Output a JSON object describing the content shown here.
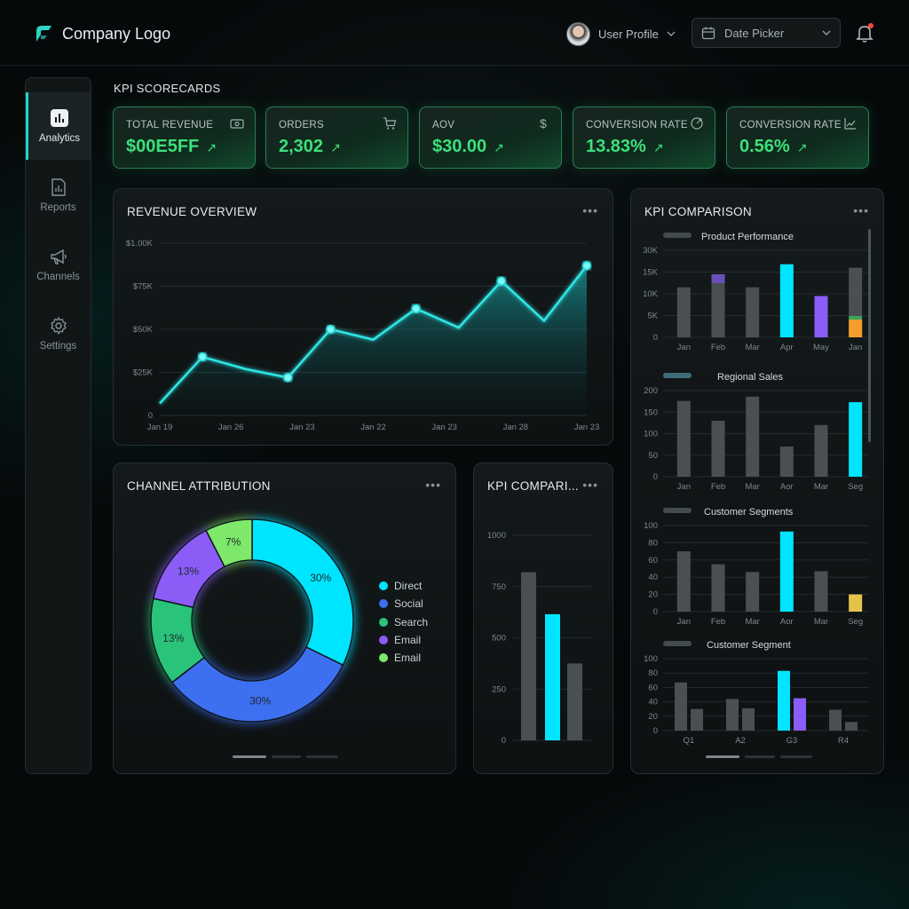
{
  "header": {
    "company": "Company Logo",
    "profile_label": "User Profile",
    "date_placeholder": "Date Picker"
  },
  "sidebar": {
    "items": [
      {
        "label": "Analytics",
        "icon": "bar-chart-icon",
        "active": true
      },
      {
        "label": "Reports",
        "icon": "document-chart-icon",
        "active": false
      },
      {
        "label": "Channels",
        "icon": "megaphone-icon",
        "active": false
      },
      {
        "label": "Settings",
        "icon": "gear-icon",
        "active": false
      }
    ]
  },
  "scorecards": {
    "title": "KPI SCORECARDS",
    "cards": [
      {
        "label": "TOTAL REVENUE",
        "value": "$00E5FF",
        "trend": "↗",
        "icon": "money-icon"
      },
      {
        "label": "ORDERS",
        "value": "2,302",
        "trend": "↗",
        "icon": "cart-icon"
      },
      {
        "label": "AOV",
        "value": "$30.00",
        "trend": "↗",
        "icon": "dollar-icon"
      },
      {
        "label": "CONVERSION RATE",
        "value": "13.83%",
        "trend": "↗",
        "icon": "target-icon"
      },
      {
        "label": "CONVERSION RATE",
        "value": "0.56%",
        "trend": "↗",
        "icon": "trend-icon"
      }
    ]
  },
  "colors": {
    "accent": "#00E5FF",
    "green": "#3DE07A",
    "blue": "#3D6FF0",
    "purple": "#8B5CF6",
    "lime": "#7EE86A",
    "gray_bar": "#4A4F51",
    "orange": "#F59E2B",
    "yellow": "#E5C34A"
  },
  "revenue_overview": {
    "title": "REVENUE OVERVIEW",
    "menu": "•••",
    "chart_data": {
      "type": "area",
      "x": [
        "Jan 19",
        "Jan 26",
        "Jan 23",
        "Jan 22",
        "Jan 23",
        "Jan 28",
        "Jan 23"
      ],
      "y_ticks": [
        "0",
        "$25K",
        "$50K",
        "$75K",
        "$1.00K"
      ],
      "ylim": [
        0,
        100
      ],
      "values": [
        7,
        34,
        27,
        22,
        50,
        44,
        62,
        51,
        78,
        55,
        87
      ],
      "markers": [
        1,
        3,
        4,
        6,
        8,
        10
      ]
    }
  },
  "kpi_comparison": {
    "title": "KPI COMPARISON",
    "menu": "•••",
    "charts": [
      {
        "title": "Product Performance",
        "type": "bar",
        "y_ticks": [
          "0",
          "5K",
          "10K",
          "15K",
          "30K"
        ],
        "ylim": [
          0,
          20
        ],
        "categories": [
          "Jan",
          "Feb",
          "Mar",
          "Apr",
          "May",
          "Jan"
        ],
        "values": [
          11.5,
          14.5,
          11.5,
          16.8,
          9.5,
          16
        ],
        "colors": [
          "gray",
          "gray-purple",
          "gray",
          "accent",
          "purple",
          "gray-orange"
        ]
      },
      {
        "title": "Regional Sales",
        "type": "bar",
        "y_ticks": [
          "0",
          "50",
          "100",
          "150",
          "200"
        ],
        "ylim": [
          0,
          200
        ],
        "categories": [
          "Jan",
          "Feb",
          "Mar",
          "Aor",
          "Mar",
          "Seg"
        ],
        "values": [
          176,
          130,
          186,
          70,
          120,
          173
        ],
        "colors": [
          "gray",
          "gray",
          "gray",
          "gray",
          "gray",
          "accent"
        ]
      },
      {
        "title": "Customer Segments",
        "type": "bar",
        "y_ticks": [
          "0",
          "20",
          "40",
          "60",
          "80",
          "100"
        ],
        "ylim": [
          0,
          100
        ],
        "categories": [
          "Jan",
          "Feb",
          "Mar",
          "Aor",
          "Mar",
          "Seg"
        ],
        "values": [
          70,
          55,
          46,
          93,
          47,
          20
        ],
        "colors": [
          "gray",
          "gray",
          "gray",
          "accent",
          "gray",
          "yellow"
        ]
      },
      {
        "title": "Customer Segment",
        "type": "bar",
        "y_ticks": [
          "0",
          "20",
          "40",
          "60",
          "80",
          "100"
        ],
        "ylim": [
          0,
          100
        ],
        "categories": [
          "Q1",
          "A2",
          "G3",
          "R4"
        ],
        "series": [
          {
            "values": [
              67,
              44,
              83,
              29
            ]
          },
          {
            "values": [
              30,
              31,
              45,
              12
            ]
          }
        ]
      }
    ]
  },
  "channel_attribution": {
    "title": "CHANNEL ATTRIBUTION",
    "menu": "•••",
    "chart_data": {
      "type": "pie",
      "slices": [
        {
          "label": "30%",
          "value": 30,
          "color": "accent"
        },
        {
          "label": "30%",
          "value": 30,
          "color": "blue"
        },
        {
          "label": "13%",
          "value": 13,
          "color": "green"
        },
        {
          "label": "13%",
          "value": 13,
          "color": "purple"
        },
        {
          "label": "7%",
          "value": 7,
          "color": "lime"
        }
      ],
      "legend": [
        {
          "label": "Direct",
          "color": "#00E5FF"
        },
        {
          "label": "Social",
          "color": "#3D6FF0"
        },
        {
          "label": "Search",
          "color": "#2BC37A"
        },
        {
          "label": "Email",
          "color": "#8B5CF6"
        },
        {
          "label": "Email",
          "color": "#7EE86A"
        }
      ]
    }
  },
  "kpi_comparison_small": {
    "title": "KPI COMPARI...",
    "menu": "•••",
    "chart_data": {
      "type": "bar",
      "y_ticks": [
        "0",
        "250",
        "500",
        "750",
        "1000"
      ],
      "ylim": [
        0,
        1000
      ],
      "values": [
        820,
        615,
        375
      ],
      "colors": [
        "gray",
        "accent",
        "gray"
      ]
    }
  }
}
